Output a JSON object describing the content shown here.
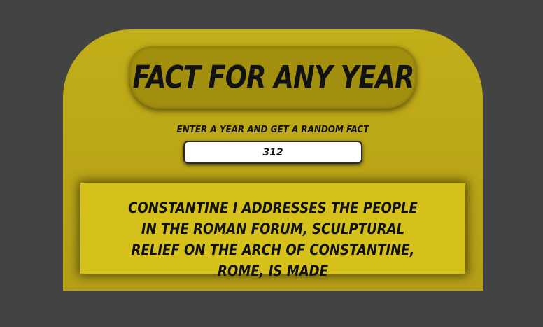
{
  "app": {
    "title": "Fact For Any Year"
  },
  "form": {
    "label": "Enter a year and get a random fact",
    "year_value": "312"
  },
  "result": {
    "fact": "Constantine I addresses the people in the Roman Forum, sculptural relief on the Arch of Constantine, Rome, is made"
  },
  "colors": {
    "background": "#434343",
    "card": "#c2ae18",
    "title_pill": "#a38f0e",
    "fact_box": "#d6c11a"
  }
}
